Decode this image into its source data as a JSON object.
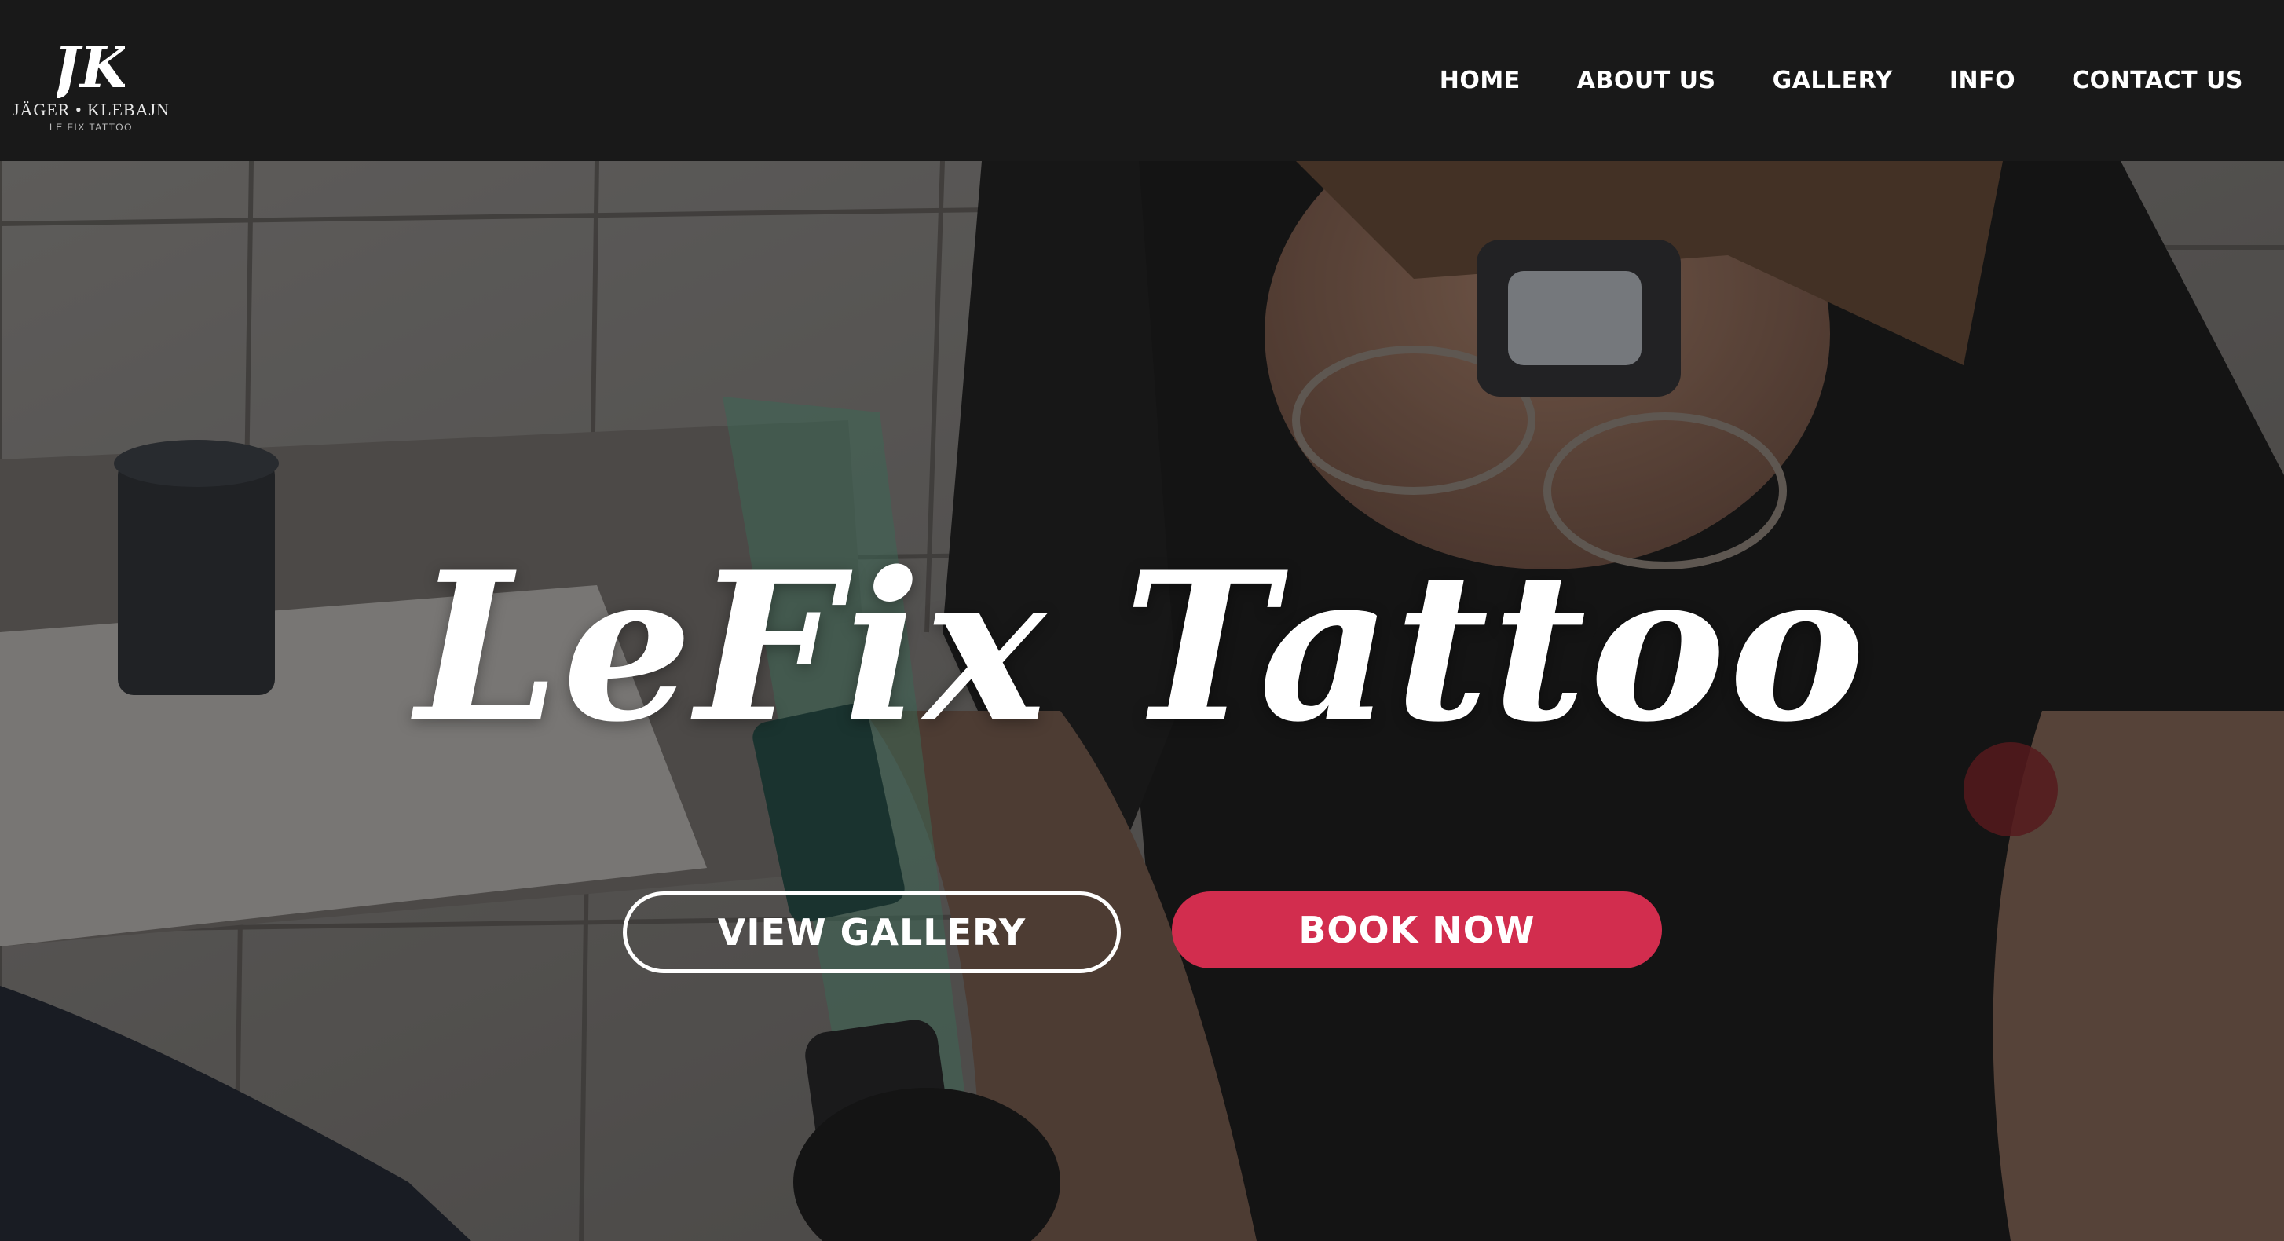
{
  "header": {
    "logo": {
      "monogram": "JK",
      "name": "JÄGER • KLEBAJN",
      "subtitle": "LE FIX TATTOO"
    },
    "nav": [
      {
        "label": "HOME"
      },
      {
        "label": "ABOUT US"
      },
      {
        "label": "GALLERY"
      },
      {
        "label": "INFO"
      },
      {
        "label": "CONTACT US"
      }
    ]
  },
  "hero": {
    "title": "LeFix Tattoo",
    "buttons": {
      "view_gallery": "VIEW GALLERY",
      "book_now": "BOOK NOW"
    }
  },
  "colors": {
    "header_bg": "#191919",
    "accent": "#d22d4e",
    "text": "#ffffff"
  }
}
